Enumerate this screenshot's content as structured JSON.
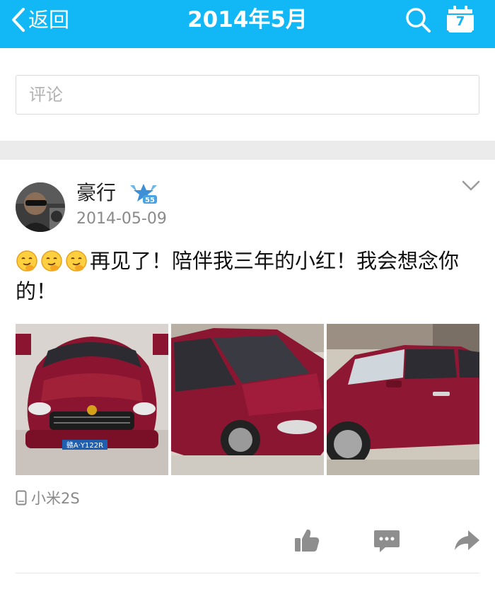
{
  "header": {
    "back_label": "返回",
    "title": "2014年5月",
    "calendar_day": "7",
    "icons": [
      "back-chevron-icon",
      "search-icon",
      "calendar-icon"
    ],
    "background_color": "#12b7f5"
  },
  "comment": {
    "placeholder": "评论"
  },
  "post": {
    "author": "豪行",
    "badge_text": "55",
    "date": "2014-05-09",
    "emojis": [
      "emoji-1",
      "emoji-2",
      "emoji-3"
    ],
    "text": "再见了！陪伴我三年的小红！我会想念你的！",
    "photos": [
      {
        "plate": "赣A·Y122R"
      },
      {
        "plate": ""
      },
      {
        "plate": ""
      }
    ],
    "device": "小米2S",
    "actions": [
      "like-icon",
      "comment-icon",
      "share-icon"
    ]
  }
}
